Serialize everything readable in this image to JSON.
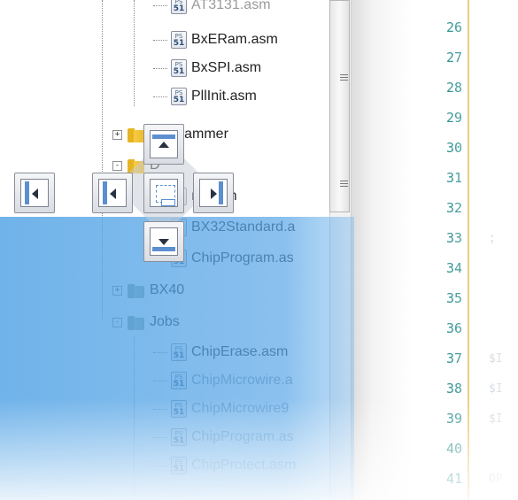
{
  "tree": {
    "items": [
      {
        "label": "AT3131.asm",
        "kind": "file"
      },
      {
        "label": "BxERam.asm",
        "kind": "file"
      },
      {
        "label": "BxSPI.asm",
        "kind": "file"
      },
      {
        "label": "PllInit.asm",
        "kind": "file"
      },
      {
        "label": "Programmer",
        "kind": "folder",
        "expander": "+"
      },
      {
        "label": "D",
        "kind": "folder",
        "expander": "-"
      },
      {
        "label": "nit.asm",
        "kind": "file"
      },
      {
        "label": "BX32Standard.a",
        "kind": "file"
      },
      {
        "label": "ChipProgram.as",
        "kind": "file"
      },
      {
        "label": "BX40",
        "kind": "folder",
        "expander": "+"
      },
      {
        "label": "Jobs",
        "kind": "folder",
        "expander": "-"
      },
      {
        "label": "ChipErase.asm",
        "kind": "file"
      },
      {
        "label": "ChipMicrowire.a",
        "kind": "file"
      },
      {
        "label": "ChipMicrowire9",
        "kind": "file"
      },
      {
        "label": "ChipProgram.as",
        "kind": "file"
      },
      {
        "label": "ChipProtect.asm",
        "kind": "file"
      }
    ],
    "file_icon": {
      "line1": "PS",
      "line2": "51"
    }
  },
  "editor": {
    "line_numbers": [
      "26",
      "27",
      "28",
      "29",
      "30",
      "31",
      "32",
      "33",
      "34",
      "35",
      "36",
      "37",
      "38",
      "39",
      "40",
      "41"
    ],
    "code_fragments": [
      {
        "line": "33",
        "text": ";"
      },
      {
        "line": "37",
        "text": "$I"
      },
      {
        "line": "38",
        "text": "$I"
      },
      {
        "line": "39",
        "text": "$I"
      },
      {
        "line": "41",
        "text": "OP"
      }
    ]
  },
  "colors": {
    "dock_highlight": "#4ca0e4",
    "line_number": "#238a8a",
    "gutter_marker": "#e3b64a"
  }
}
